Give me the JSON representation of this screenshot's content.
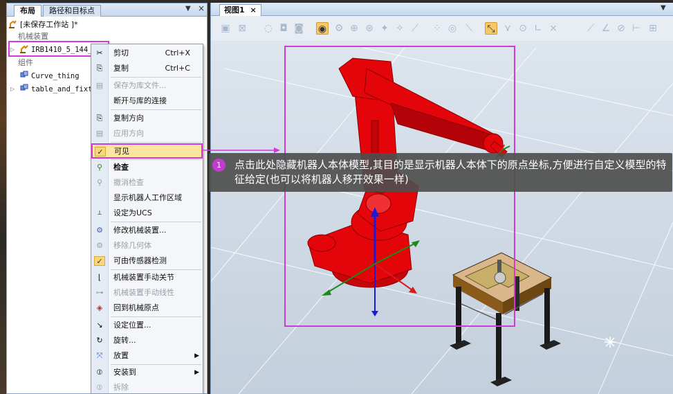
{
  "layout_panel": {
    "tabs": [
      "布局",
      "路径和目标点"
    ],
    "pin": "▼",
    "close": "×",
    "station": "[未保存工作站 ]*",
    "mechanisms_header": "机械装置",
    "robot": "IRB1410_5_144_",
    "components_header": "组件",
    "components": [
      "Curve_thing",
      "table_and_fixt"
    ]
  },
  "context_menu": {
    "items": [
      {
        "label": "剪切",
        "shortcut": "Ctrl+X",
        "icon": "cut-icon"
      },
      {
        "label": "复制",
        "shortcut": "Ctrl+C",
        "icon": "copy-icon"
      },
      {
        "label": "保存为库文件...",
        "icon": "save-library-icon"
      },
      {
        "label": "断开与库的连接",
        "icon": "disconnect-library-icon"
      },
      {
        "label": "复制方向",
        "icon": "copy-orientation-icon"
      },
      {
        "label": "应用方向",
        "icon": "apply-orientation-icon"
      },
      {
        "label": "可见",
        "icon": "checkmark-icon"
      },
      {
        "label": "检查",
        "icon": "inspect-icon"
      },
      {
        "label": "撤消检查",
        "icon": "undo-inspect-icon"
      },
      {
        "label": "显示机器人工作区域",
        "icon": ""
      },
      {
        "label": "设定为UCS",
        "icon": "ucs-icon"
      },
      {
        "label": "修改机械装置...",
        "icon": "modify-mechanism-icon"
      },
      {
        "label": "移除几何体",
        "icon": "remove-geometry-icon"
      },
      {
        "label": "可由传感器检测",
        "icon": "checkmark-icon"
      },
      {
        "label": "机械装置手动关节",
        "icon": "jog-joint-icon"
      },
      {
        "label": "机械装置手动线性",
        "icon": "jog-linear-icon"
      },
      {
        "label": "回到机械原点",
        "icon": "home-icon"
      },
      {
        "label": "设定位置...",
        "icon": "set-position-icon"
      },
      {
        "label": "旋转...",
        "icon": "rotate-icon"
      },
      {
        "label": "放置",
        "icon": "place-icon"
      },
      {
        "label": "安装到",
        "icon": "attach-icon"
      },
      {
        "label": "拆除",
        "icon": "detach-icon"
      }
    ]
  },
  "view_panel": {
    "tab": "视图1",
    "close": "×",
    "pin": "▼"
  },
  "callout": {
    "number": "1",
    "text": "点击此处隐藏机器人本体模型,其目的是显示机器人本体下的原点坐标,方便进行自定义模型的特征给定(也可以将机器人移开效果一样)"
  },
  "colors": {
    "highlight_magenta": "#d23ad8",
    "robot_red": "#e4050b",
    "menu_highlight": "#fbe5a0"
  }
}
